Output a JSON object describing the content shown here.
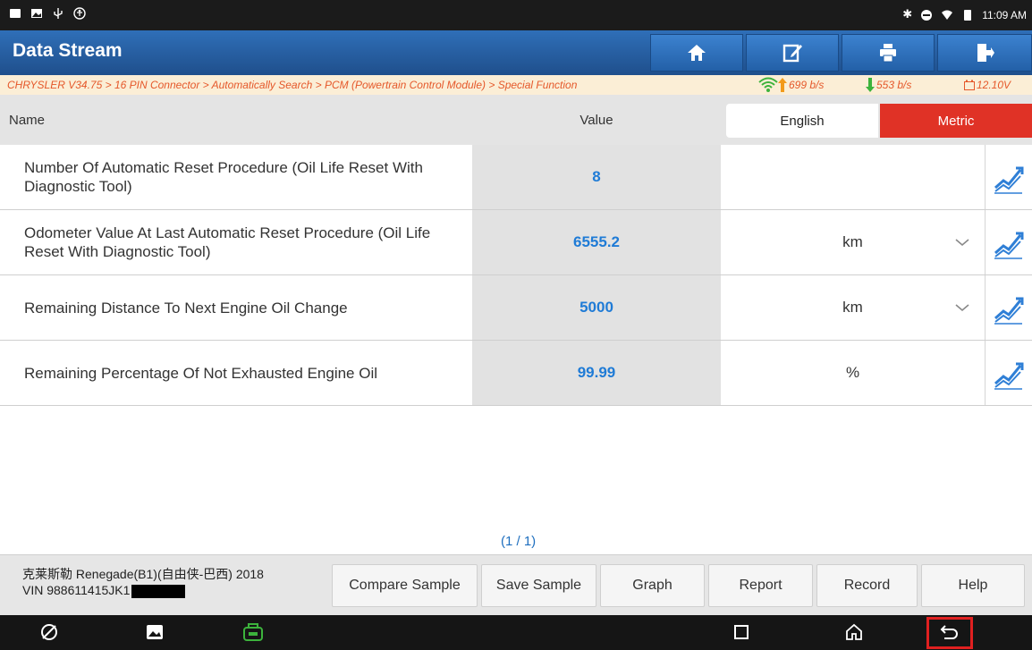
{
  "status_bar": {
    "time": "11:09 AM"
  },
  "header": {
    "title": "Data Stream"
  },
  "toolbar_icons": [
    "home-icon",
    "edit-icon",
    "print-icon",
    "exit-icon"
  ],
  "breadcrumb": {
    "path": "CHRYSLER V34.75 > 16 PIN Connector > Automatically Search > PCM (Powertrain Control Module) > Special Function",
    "upload": "699 b/s",
    "download": "553 b/s",
    "voltage": "12.10V"
  },
  "table": {
    "col_name": "Name",
    "col_value": "Value",
    "unit_toggle": {
      "english": "English",
      "metric": "Metric",
      "selected": "Metric"
    },
    "rows": [
      {
        "name": "Number Of Automatic Reset Procedure (Oil Life Reset With Diagnostic Tool)",
        "value": "8",
        "unit": ""
      },
      {
        "name": "Odometer Value At Last Automatic Reset Procedure (Oil Life Reset With Diagnostic Tool)",
        "value": "6555.2",
        "unit": "km"
      },
      {
        "name": "Remaining Distance To Next Engine Oil Change",
        "value": "5000",
        "unit": "km"
      },
      {
        "name": "Remaining Percentage Of Not Exhausted Engine Oil",
        "value": "99.99",
        "unit": "%"
      }
    ]
  },
  "pager": "(1 / 1)",
  "vehicle": {
    "model": "克莱斯勒 Renegade(B1)(自由侠-巴西) 2018",
    "vin": "VIN 988611415JK1"
  },
  "buttons": {
    "compare": "Compare Sample",
    "save": "Save Sample",
    "graph": "Graph",
    "report": "Report",
    "record": "Record",
    "help": "Help"
  },
  "colors": {
    "accent_blue": "#2f6fb8",
    "metric_red": "#e03226",
    "value_blue": "#1f7bd6",
    "breadcrumb_orange": "#e5582a"
  }
}
